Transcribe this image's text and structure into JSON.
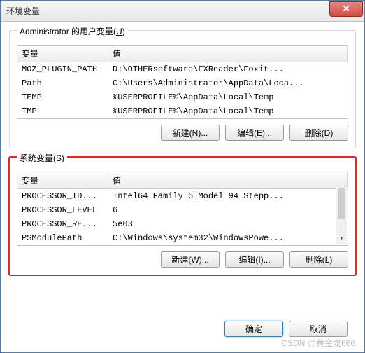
{
  "window": {
    "title": "环境变量"
  },
  "close_icon": "✕",
  "user_group": {
    "legend": "Administrator 的用户变量(",
    "legend_key": "U",
    "legend_tail": ")",
    "header_var": "变量",
    "header_val": "值",
    "rows": [
      {
        "var": "MOZ_PLUGIN_PATH",
        "val": "D:\\OTHERsoftware\\FXReader\\Foxit..."
      },
      {
        "var": "Path",
        "val": "C:\\Users\\Administrator\\AppData\\Loca..."
      },
      {
        "var": "TEMP",
        "val": "%USERPROFILE%\\AppData\\Local\\Temp"
      },
      {
        "var": "TMP",
        "val": "%USERPROFILE%\\AppData\\Local\\Temp"
      }
    ],
    "buttons": {
      "new": "新建(N)...",
      "edit": "编辑(E)...",
      "delete": "删除(D)"
    }
  },
  "sys_group": {
    "legend": "系统变量(",
    "legend_key": "S",
    "legend_tail": ")",
    "header_var": "变量",
    "header_val": "值",
    "rows": [
      {
        "var": "PROCESSOR_ID...",
        "val": "Intel64 Family 6 Model 94 Stepp..."
      },
      {
        "var": "PROCESSOR_LEVEL",
        "val": "6"
      },
      {
        "var": "PROCESSOR_RE...",
        "val": "5e03"
      },
      {
        "var": "PSModulePath",
        "val": "C:\\Windows\\system32\\WindowsPowe..."
      }
    ],
    "buttons": {
      "new": "新建(W)...",
      "edit": "编辑(I)...",
      "delete": "删除(L)"
    }
  },
  "footer": {
    "ok": "确定",
    "cancel": "取消"
  },
  "watermark": "CSDN @黄金龙666"
}
